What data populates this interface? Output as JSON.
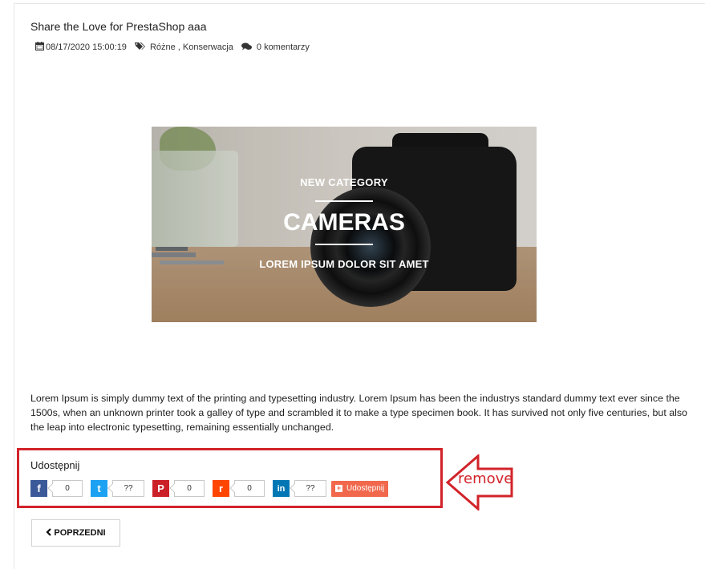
{
  "post": {
    "title": "Share the Love for PrestaShop aaa",
    "date": "08/17/2020 15:00:19",
    "categories": "Różne , Konserwacja",
    "comments": "0 komentarzy"
  },
  "banner": {
    "kicker": "NEW CATEGORY",
    "headline": "CAMERAS",
    "subline": "LOREM IPSUM DOLOR SIT AMET"
  },
  "body_text": "Lorem Ipsum is simply dummy text of the printing and typesetting industry. Lorem Ipsum has been the industrys standard dummy text ever since the 1500s, when an unknown printer took a galley of type and scrambled it to make a type specimen book. It has survived not only five centuries, but also the leap into electronic typesetting, remaining essentially unchanged.",
  "share": {
    "label": "Udostępnij",
    "buttons": [
      {
        "icon": "facebook-icon",
        "glyph": "f",
        "color": "#3b5998",
        "count": "0"
      },
      {
        "icon": "twitter-icon",
        "glyph": "t",
        "color": "#1da1f2",
        "count": "??"
      },
      {
        "icon": "pinterest-icon",
        "glyph": "P",
        "color": "#cb2027",
        "count": "0"
      },
      {
        "icon": "reddit-icon",
        "glyph": "r",
        "color": "#ff4500",
        "count": "0"
      },
      {
        "icon": "linkedin-icon",
        "glyph": "in",
        "color": "#0077b5",
        "count": "??"
      }
    ],
    "more_label": "Udostępnij",
    "more_color": "#f1684c"
  },
  "annotation": {
    "text": "remove",
    "color": "#d2232a"
  },
  "navigation": {
    "prev_label": "POPRZEDNI"
  }
}
